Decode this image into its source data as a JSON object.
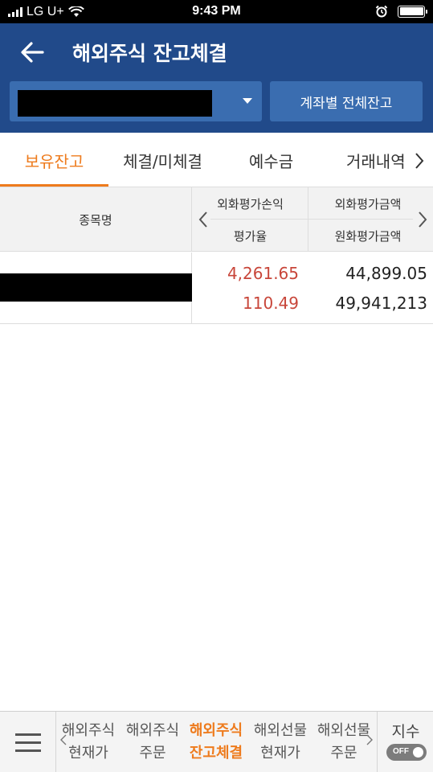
{
  "status_bar": {
    "carrier": "LG U+",
    "time": "9:43 PM"
  },
  "header": {
    "title": "해외주식 잔고체결",
    "total_balance_button": "계좌별 전체잔고"
  },
  "tabs": [
    {
      "label": "보유잔고",
      "active": true
    },
    {
      "label": "체결/미체결",
      "active": false
    },
    {
      "label": "예수금",
      "active": false
    },
    {
      "label": "거래내역",
      "active": false
    }
  ],
  "table": {
    "header": {
      "name": "종목명",
      "col1_top": "외화평가손익",
      "col1_bottom": "평가율",
      "col2_top": "외화평가금액",
      "col2_bottom": "원화평가금액"
    },
    "rows": [
      {
        "foreign_pl": "4,261.65",
        "eval_rate": "110.49",
        "foreign_amount": "44,899.05",
        "krw_amount": "49,941,213"
      }
    ]
  },
  "bottom_nav": {
    "items": [
      {
        "line1": "해외주식",
        "line2": "현재가",
        "active": false
      },
      {
        "line1": "해외주식",
        "line2": "주문",
        "active": false
      },
      {
        "line1": "해외주식",
        "line2": "잔고체결",
        "active": true
      },
      {
        "line1": "해외선물",
        "line2": "현재가",
        "active": false
      },
      {
        "line1": "해외선물",
        "line2": "주문",
        "active": false
      }
    ],
    "index_label": "지수",
    "index_toggle": "OFF"
  },
  "colors": {
    "header_bg": "#214a8a",
    "accent": "#ee7b1d",
    "positive": "#c8463a"
  }
}
